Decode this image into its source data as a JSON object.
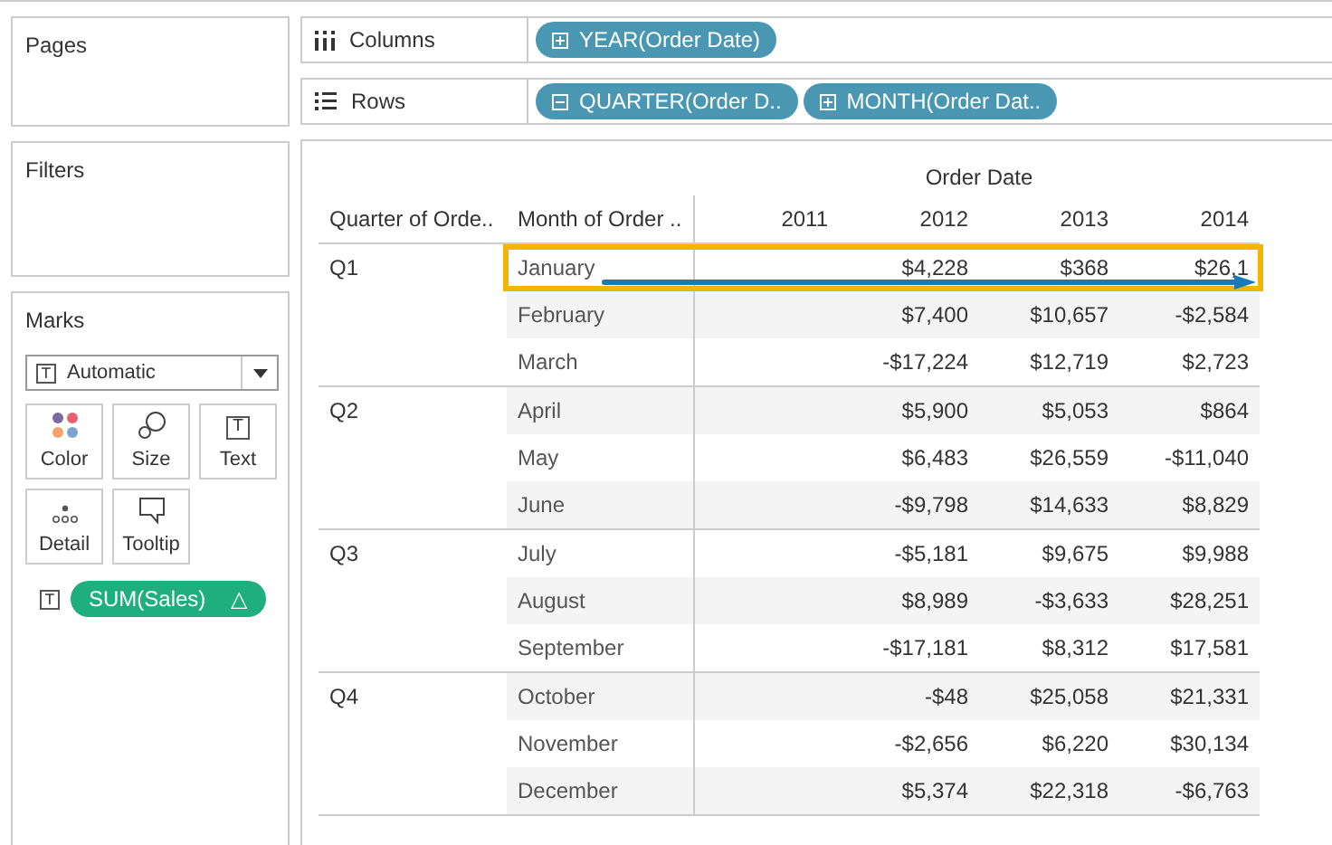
{
  "pages": {
    "title": "Pages"
  },
  "filters": {
    "title": "Filters"
  },
  "marks": {
    "title": "Marks",
    "mark_type_icon": "T",
    "mark_type": "Automatic",
    "cards": [
      {
        "label": "Color",
        "kind": "color"
      },
      {
        "label": "Size",
        "kind": "size"
      },
      {
        "label": "Text",
        "kind": "text",
        "glyph": "T"
      },
      {
        "label": "Detail",
        "kind": "detail"
      },
      {
        "label": "Tooltip",
        "kind": "tooltip"
      }
    ],
    "field_pill": {
      "icon": "T",
      "label": "SUM(Sales)",
      "symbol": "△"
    }
  },
  "shelves": [
    {
      "label": "Columns",
      "kind": "columns",
      "pills": [
        {
          "label": "YEAR(Order Date)",
          "expanded": false
        }
      ]
    },
    {
      "label": "Rows",
      "kind": "rows",
      "pills": [
        {
          "label": "QUARTER(Order D..",
          "expanded": true
        },
        {
          "label": "MONTH(Order Dat..",
          "expanded": false
        }
      ]
    }
  ],
  "table": {
    "column_group": "Order Date",
    "row_headers": [
      "Quarter of Orde..",
      "Month of Order .."
    ],
    "years": [
      "2011",
      "2012",
      "2013",
      "2014"
    ],
    "quarters": [
      {
        "label": "Q1",
        "months": [
          {
            "month": "January",
            "highlighted": true,
            "cells": [
              null,
              "$4,228",
              "$368",
              "$26,1"
            ]
          },
          {
            "month": "February",
            "highlighted": false,
            "cells": [
              null,
              "$7,400",
              "$10,657",
              "-$2,584"
            ]
          },
          {
            "month": "March",
            "highlighted": false,
            "cells": [
              null,
              "-$17,224",
              "$12,719",
              "$2,723"
            ]
          }
        ]
      },
      {
        "label": "Q2",
        "months": [
          {
            "month": "April",
            "highlighted": false,
            "cells": [
              null,
              "$5,900",
              "$5,053",
              "$864"
            ]
          },
          {
            "month": "May",
            "highlighted": false,
            "cells": [
              null,
              "$6,483",
              "$26,559",
              "-$11,040"
            ]
          },
          {
            "month": "June",
            "highlighted": false,
            "cells": [
              null,
              "-$9,798",
              "$14,633",
              "$8,829"
            ]
          }
        ]
      },
      {
        "label": "Q3",
        "months": [
          {
            "month": "July",
            "highlighted": false,
            "cells": [
              null,
              "-$5,181",
              "$9,675",
              "$9,988"
            ]
          },
          {
            "month": "August",
            "highlighted": false,
            "cells": [
              null,
              "$8,989",
              "-$3,633",
              "$28,251"
            ]
          },
          {
            "month": "September",
            "highlighted": false,
            "cells": [
              null,
              "-$17,181",
              "$8,312",
              "$17,581"
            ]
          }
        ]
      },
      {
        "label": "Q4",
        "months": [
          {
            "month": "October",
            "highlighted": false,
            "cells": [
              null,
              "-$48",
              "$25,058",
              "$21,331"
            ]
          },
          {
            "month": "November",
            "highlighted": false,
            "cells": [
              null,
              "-$2,656",
              "$6,220",
              "$30,134"
            ]
          },
          {
            "month": "December",
            "highlighted": false,
            "cells": [
              null,
              "$5,374",
              "$22,318",
              "-$6,763"
            ]
          }
        ]
      }
    ]
  }
}
